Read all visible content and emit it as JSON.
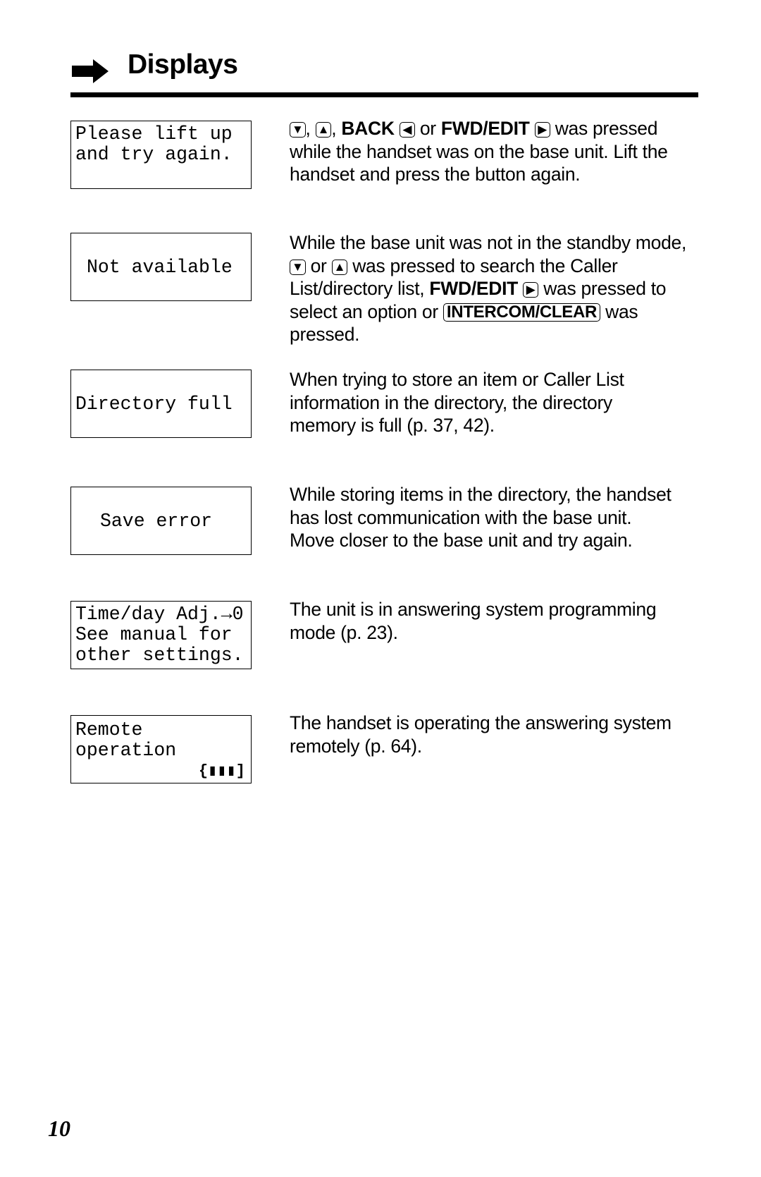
{
  "header": {
    "title": "Displays",
    "icon": "right-arrow-icon"
  },
  "entries": [
    {
      "display": [
        "Please lift up",
        "and try again."
      ],
      "description": {
        "k1": "▼",
        "sep1": ", ",
        "k2": "▲",
        "sep2": ", ",
        "back": "BACK",
        "k3": "◀",
        "or": " or ",
        "fwd": "FWD/EDIT",
        "k4": "▶",
        "rest1": " was pressed",
        "line2": "while the handset was on the base unit. Lift the",
        "line3": "handset and press the button again."
      }
    },
    {
      "display": [
        "Not available"
      ],
      "description": {
        "line1": "While the base unit was not in the standby mode,",
        "k1": "▼",
        "or": " or ",
        "k2": "▲",
        "rest2": " was pressed to search the Caller",
        "line3a": "List/directory list, ",
        "fwd": "FWD/EDIT",
        "k3": "▶",
        "line3b": " was pressed to",
        "line4a": "select an option or ",
        "intercom": "INTERCOM/CLEAR",
        "line4b": " was",
        "line5": "pressed."
      }
    },
    {
      "display": [
        "Directory full"
      ],
      "description": {
        "lines": [
          "When trying to store an item or Caller List",
          "information in the directory, the directory",
          "memory is full (p. 37, 42)."
        ]
      }
    },
    {
      "display": [
        "Save error"
      ],
      "description": {
        "lines": [
          "While storing items in the directory, the handset",
          "has lost communication with the base unit.",
          "Move closer to the base unit and try again."
        ]
      }
    },
    {
      "display": [
        "Time/day Adj.→0",
        "See manual for",
        "other settings."
      ],
      "description": {
        "lines": [
          "The unit is in answering system programming",
          "mode (p. 23)."
        ]
      }
    },
    {
      "display": [
        "Remote",
        "operation",
        "{▮▮▮]"
      ],
      "description": {
        "lines": [
          "The handset is operating the answering system",
          "remotely (p. 64)."
        ]
      }
    }
  ],
  "footer": {
    "page_number": "10"
  }
}
